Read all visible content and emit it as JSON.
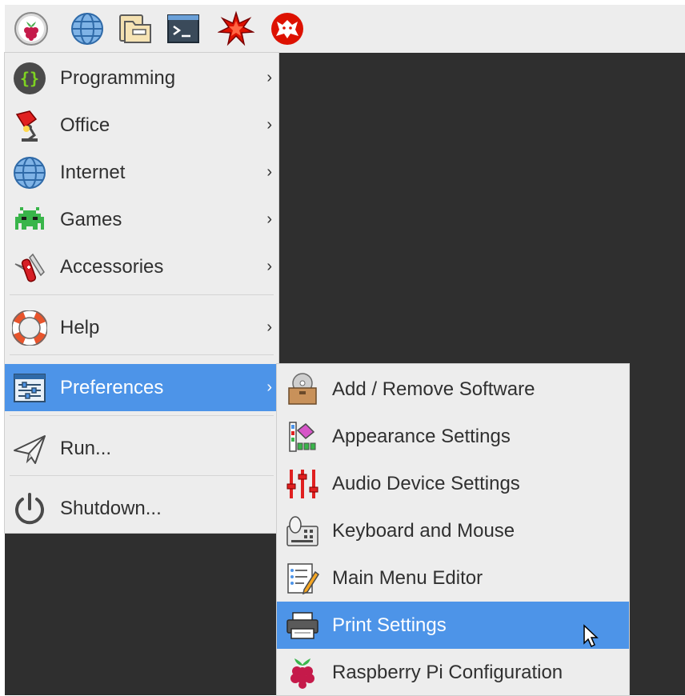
{
  "taskbar": {
    "icons": [
      "raspberry-menu-icon",
      "web-browser-icon",
      "file-manager-icon",
      "terminal-icon",
      "mathematica-icon",
      "wolfram-icon"
    ]
  },
  "main_menu": {
    "items": [
      {
        "label": "Programming",
        "icon": "programming-icon",
        "has_submenu": true
      },
      {
        "label": "Office",
        "icon": "office-lamp-icon",
        "has_submenu": true
      },
      {
        "label": "Internet",
        "icon": "globe-icon",
        "has_submenu": true
      },
      {
        "label": "Games",
        "icon": "space-invader-icon",
        "has_submenu": true
      },
      {
        "label": "Accessories",
        "icon": "pocket-knife-icon",
        "has_submenu": true
      },
      {
        "label": "Help",
        "icon": "lifebuoy-icon",
        "has_submenu": true
      },
      {
        "label": "Preferences",
        "icon": "preferences-sliders-icon",
        "has_submenu": true,
        "selected": true
      },
      {
        "label": "Run...",
        "icon": "paper-plane-icon",
        "has_submenu": false
      },
      {
        "label": "Shutdown...",
        "icon": "power-icon",
        "has_submenu": false
      }
    ],
    "arrow": "›"
  },
  "preferences_submenu": {
    "items": [
      {
        "label": "Add / Remove Software",
        "icon": "software-package-icon"
      },
      {
        "label": "Appearance Settings",
        "icon": "appearance-palette-icon"
      },
      {
        "label": "Audio Device Settings",
        "icon": "audio-mixer-icon"
      },
      {
        "label": "Keyboard and Mouse",
        "icon": "keyboard-mouse-icon"
      },
      {
        "label": "Main Menu Editor",
        "icon": "menu-editor-icon"
      },
      {
        "label": "Print Settings",
        "icon": "printer-icon",
        "selected": true
      },
      {
        "label": "Raspberry Pi Configuration",
        "icon": "raspberry-pi-icon"
      }
    ]
  },
  "colors": {
    "selection": "#4d94e8",
    "menu_bg": "#ededed",
    "desktop": "#2f2f2f"
  }
}
